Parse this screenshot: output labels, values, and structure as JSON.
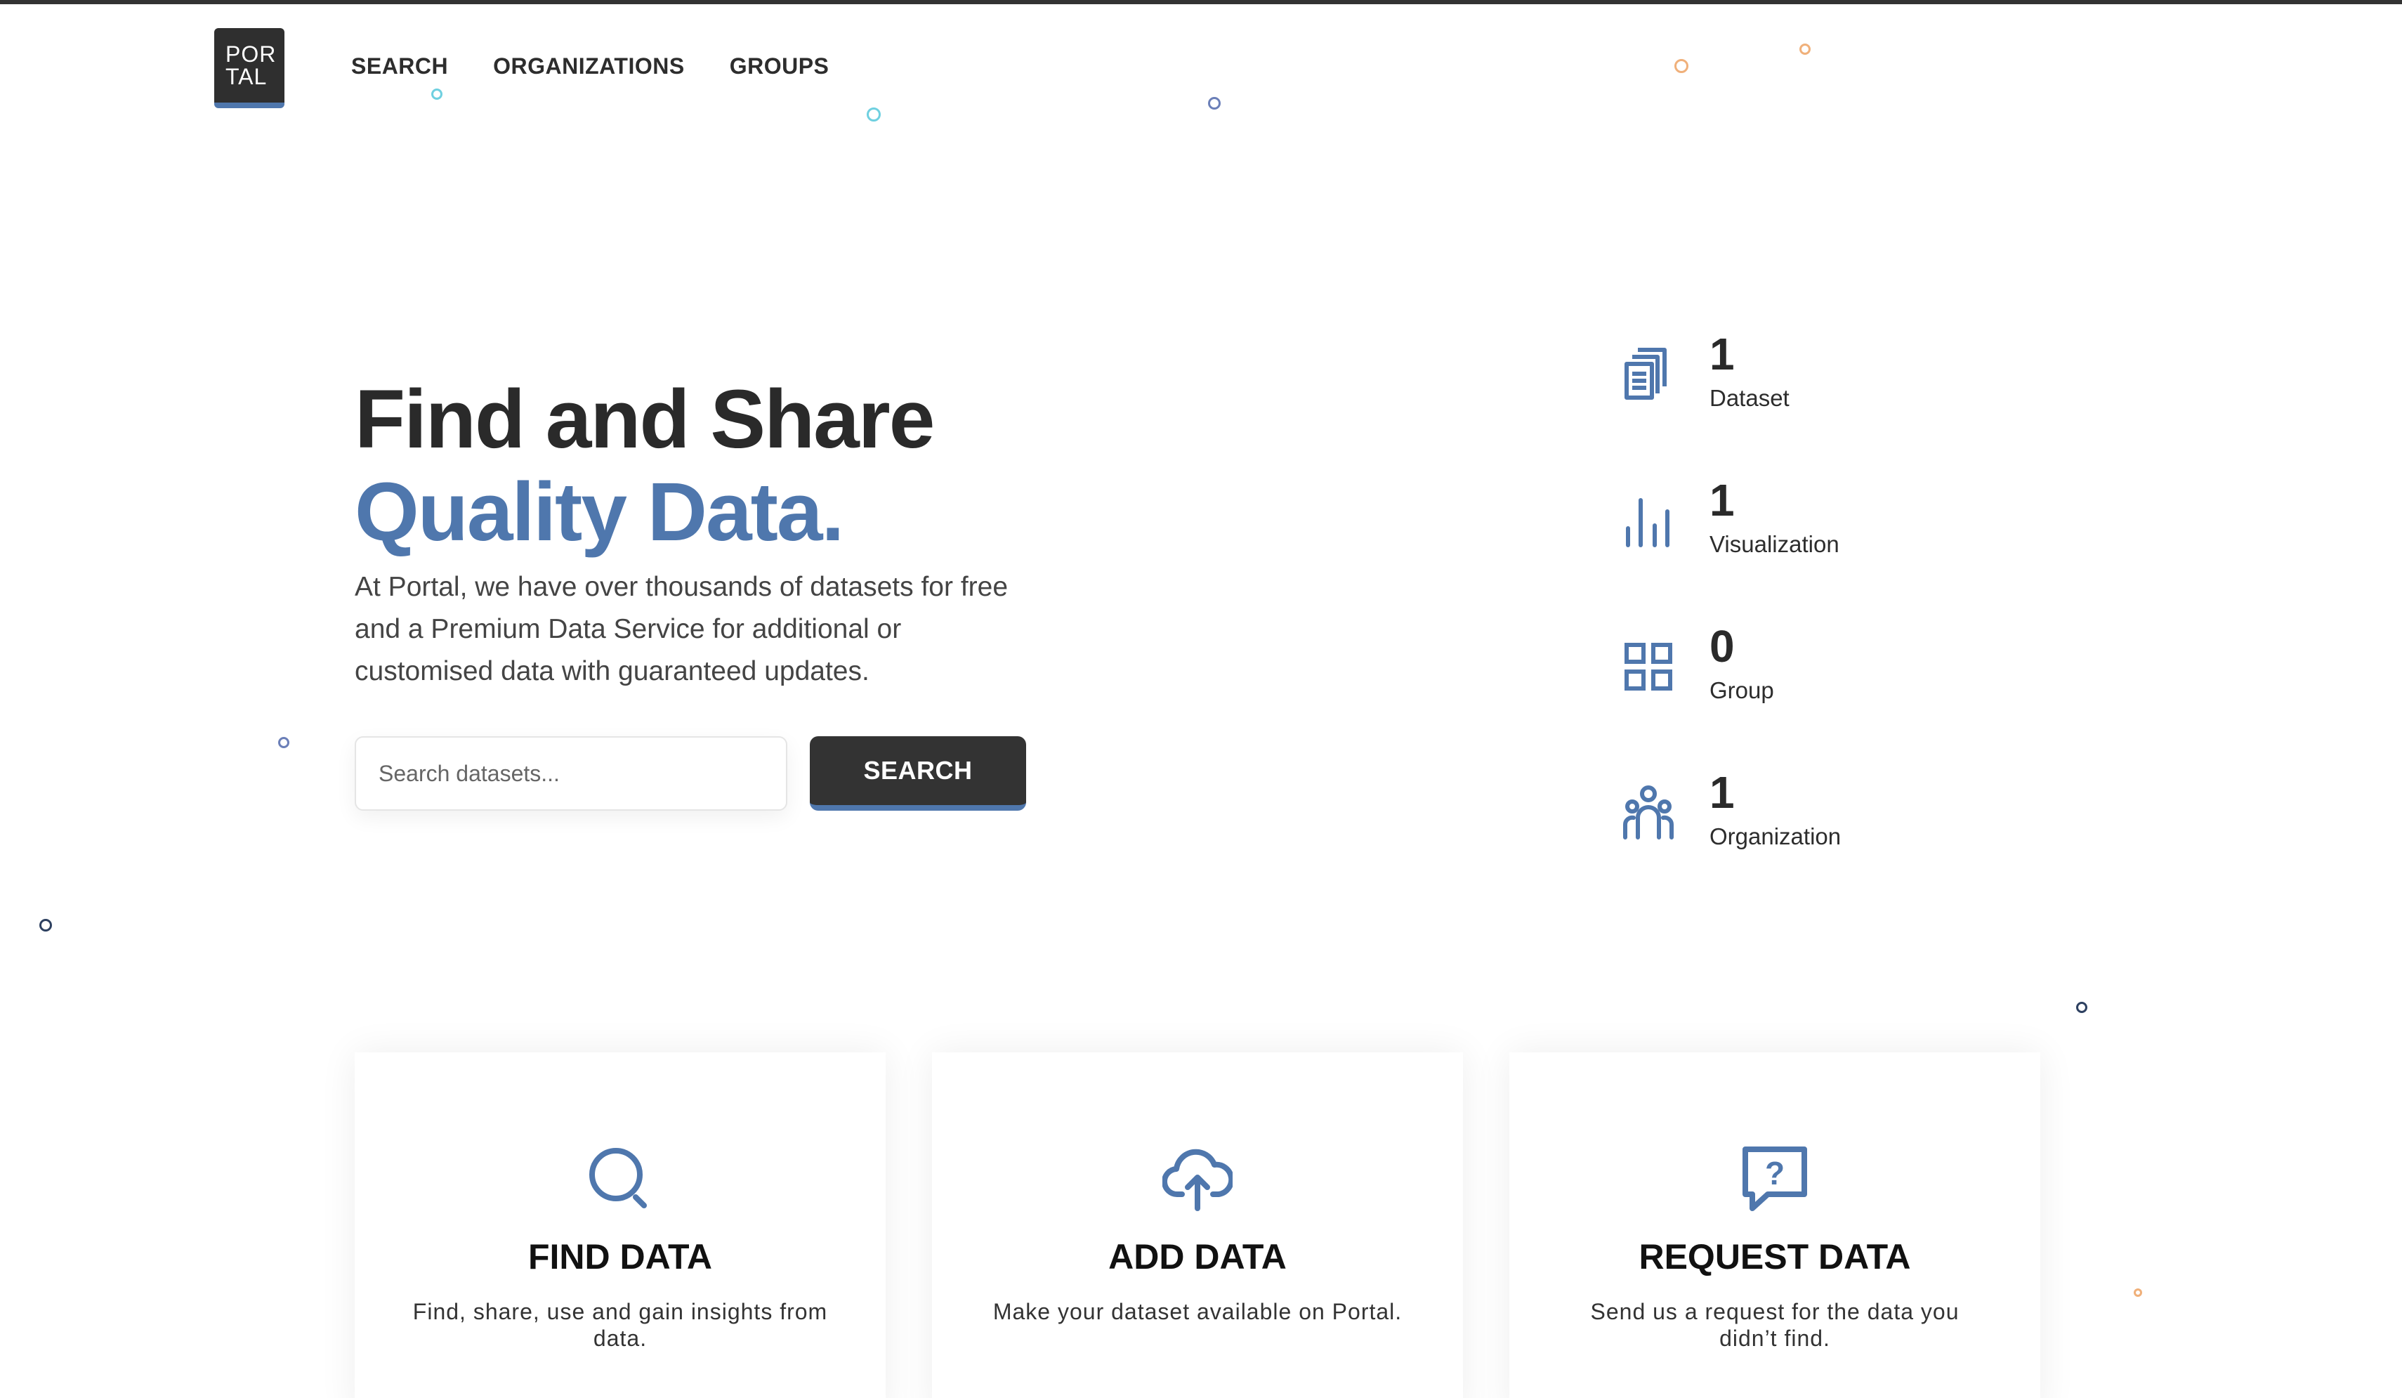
{
  "header": {
    "logo_line1": "POR",
    "logo_line2": "TAL",
    "nav": [
      "SEARCH",
      "ORGANIZATIONS",
      "GROUPS"
    ]
  },
  "hero": {
    "title_line1": "Find and Share",
    "title_line2": "Quality Data.",
    "description": "At Portal, we have over thousands of datasets for free and a Premium Data Service for additional or customised data with guaranteed updates.",
    "search_placeholder": "Search datasets...",
    "search_button": "SEARCH"
  },
  "stats": [
    {
      "icon": "dataset-icon",
      "value": "1",
      "label": "Dataset"
    },
    {
      "icon": "bar-chart-icon",
      "value": "1",
      "label": "Visualization"
    },
    {
      "icon": "grid-icon",
      "value": "0",
      "label": "Group"
    },
    {
      "icon": "people-icon",
      "value": "1",
      "label": "Organization"
    }
  ],
  "cards": [
    {
      "icon": "search-icon",
      "title": "FIND DATA",
      "description": "Find, share, use and gain insights from data."
    },
    {
      "icon": "cloud-upload-icon",
      "title": "ADD DATA",
      "description": "Make your dataset available on Portal."
    },
    {
      "icon": "question-icon",
      "title": "REQUEST DATA",
      "description": "Send us a request for the data you didn’t find."
    }
  ],
  "colors": {
    "accent": "#4f77ad",
    "dark": "#333333",
    "text": "#2d2d2d"
  }
}
